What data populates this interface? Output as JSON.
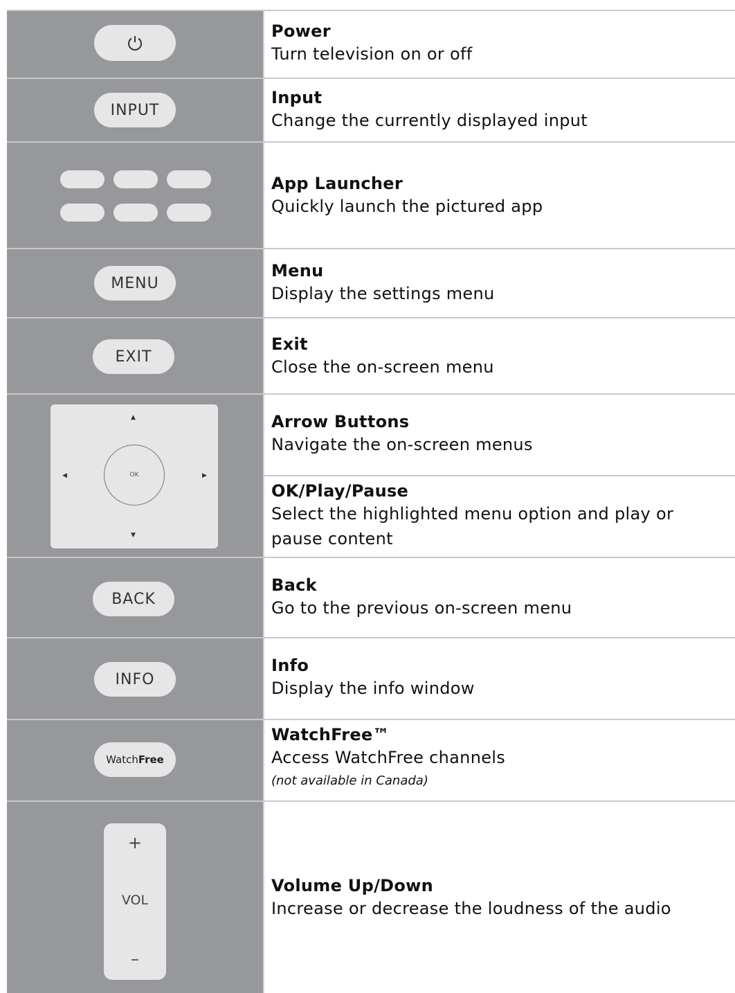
{
  "rows": [
    {
      "title": "Power",
      "desc": "Turn television on or off",
      "icon": "power-icon"
    },
    {
      "title": "Input",
      "desc": "Change the currently displayed input",
      "button_label": "INPUT"
    },
    {
      "title": "App Launcher",
      "desc": "Quickly launch the pictured app"
    },
    {
      "title": "Menu",
      "desc": "Display the settings menu",
      "button_label": "MENU"
    },
    {
      "title": "Exit",
      "desc": "Close the on-screen menu",
      "button_label": "EXIT"
    },
    {
      "title": "Arrow Buttons",
      "desc": "Navigate the on-screen menus",
      "ok_label": "OK"
    },
    {
      "title": "OK/Play/Pause",
      "desc": "Select the highlighted menu option and play or pause content"
    },
    {
      "title": "Back",
      "desc": "Go to the previous on-screen menu",
      "button_label": "BACK"
    },
    {
      "title": "Info",
      "desc": "Display the info window",
      "button_label": "INFO"
    },
    {
      "title": "WatchFree™",
      "desc": "Access WatchFree channels",
      "note": "(not available in Canada)",
      "button_label_light": "Watch",
      "button_label_bold": "Free"
    },
    {
      "title": "Volume Up/Down",
      "desc": "Increase or decrease the loudness of the audio",
      "vol_plus": "+",
      "vol_label": "VOL",
      "vol_minus": "–"
    }
  ],
  "colors": {
    "left_panel": "#97989b",
    "button": "#e6e6e6",
    "divider": "#c9c9c9"
  }
}
